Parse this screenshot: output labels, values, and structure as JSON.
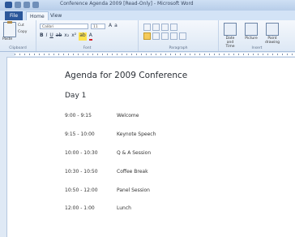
{
  "window": {
    "title": "Conference Agenda 2009 [Read-Only] - Microsoft Word"
  },
  "tabs": {
    "file": "File",
    "home": "Home",
    "view": "View"
  },
  "ribbon": {
    "paste": "Paste",
    "cut": "Cut",
    "copy": "Copy",
    "font_name": "Calibri",
    "font_size": "11",
    "groups": {
      "clipboard": "Clipboard",
      "font": "Font",
      "paragraph": "Paragraph",
      "insert": "Insert"
    },
    "picture_label": "Date and Time",
    "picture2_label": "Picture",
    "paint_label": "Paint drawing"
  },
  "document": {
    "title": "Agenda for 2009 Conference",
    "day": "Day 1",
    "rows": [
      {
        "time": "9:00 - 9:15",
        "item": "Welcome"
      },
      {
        "time": "9:15 - 10:00",
        "item": "Keynote Speech"
      },
      {
        "time": "10:00 - 10:30",
        "item": "Q & A Session"
      },
      {
        "time": "10:30 - 10:50",
        "item": "Coffee Break"
      },
      {
        "time": "10:50 - 12:00",
        "item": "Panel Session"
      },
      {
        "time": "12:00 - 1:00",
        "item": "Lunch"
      }
    ]
  }
}
